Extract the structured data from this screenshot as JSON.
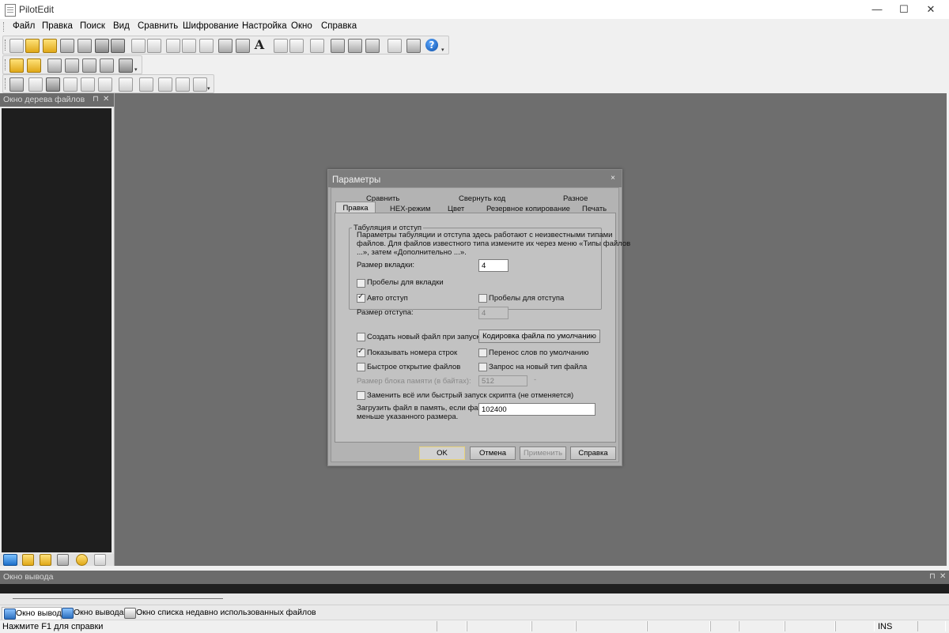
{
  "window": {
    "title": "PilotEdit",
    "minimize": "—",
    "maximize": "☐",
    "close": "✕"
  },
  "menu": [
    "Файл",
    "Правка",
    "Поиск",
    "Вид",
    "Сравнить",
    "Шифрование",
    "Настройка",
    "Окно",
    "Справка"
  ],
  "toolbar_text": {
    "font_icon": "A",
    "help_icon": "?"
  },
  "left_panel": {
    "title": "Окно дерева файлов",
    "pin": "⊓",
    "close": "✕"
  },
  "output": {
    "title": "Окно вывода",
    "pin": "⊓",
    "close": "✕",
    "tabs": [
      "Окно вывода",
      "Окно вывода 2",
      "Окно списка недавно использованных файлов"
    ]
  },
  "status": {
    "message": "Нажмите F1 для справки",
    "mode": "INS"
  },
  "dialog": {
    "title": "Параметры",
    "close": "×",
    "tabs_row1": [
      "Сравнить",
      "Свернуть код",
      "Разное"
    ],
    "tabs_row2": [
      "Правка",
      "HEX-режим",
      "Цвет",
      "Резервное копирование",
      "Печать"
    ],
    "group_title": "Табуляция и отступ",
    "group_desc": [
      "Параметры табуляции и отступа здесь работают с неизвестными типами",
      "файлов. Для файлов известного типа измените их через меню «Типы файлов",
      "...», затем «Дополнительно ...»."
    ],
    "tab_size_label": "Размер вкладки:",
    "tab_size_value": "4",
    "spaces_for_tab": {
      "label": "Пробелы для вкладки",
      "checked": false
    },
    "auto_indent": {
      "label": "Авто отступ",
      "checked": true
    },
    "spaces_for_indent": {
      "label": "Пробелы для отступа",
      "checked": false
    },
    "indent_size_label": "Размер отступа:",
    "indent_size_value": "4",
    "new_file_on_start": {
      "label": "Создать новый файл при запуске",
      "checked": false
    },
    "default_encoding_button": "Кодировка файла по умолчанию",
    "show_line_numbers": {
      "label": "Показывать номера строк",
      "checked": true
    },
    "word_wrap_default": {
      "label": "Перенос слов по умолчанию",
      "checked": false
    },
    "fast_open": {
      "label": "Быстрое открытие файлов",
      "checked": false
    },
    "ask_new_file_type": {
      "label": "Запрос на новый тип файла",
      "checked": false
    },
    "memory_block_label": "Размер блока памяти (в байтах):",
    "memory_block_value": "512",
    "memory_block_unit": "-",
    "replace_all_script": {
      "label": "Заменить всё или быстрый запуск скрипта (не отменяется)",
      "checked": false
    },
    "load_in_memory_label": [
      "Загрузить файл в память, если файл",
      "меньше указанного размера."
    ],
    "load_in_memory_value": "102400",
    "buttons": {
      "ok": "OK",
      "cancel": "Отмена",
      "apply": "Применить",
      "help": "Справка"
    }
  }
}
